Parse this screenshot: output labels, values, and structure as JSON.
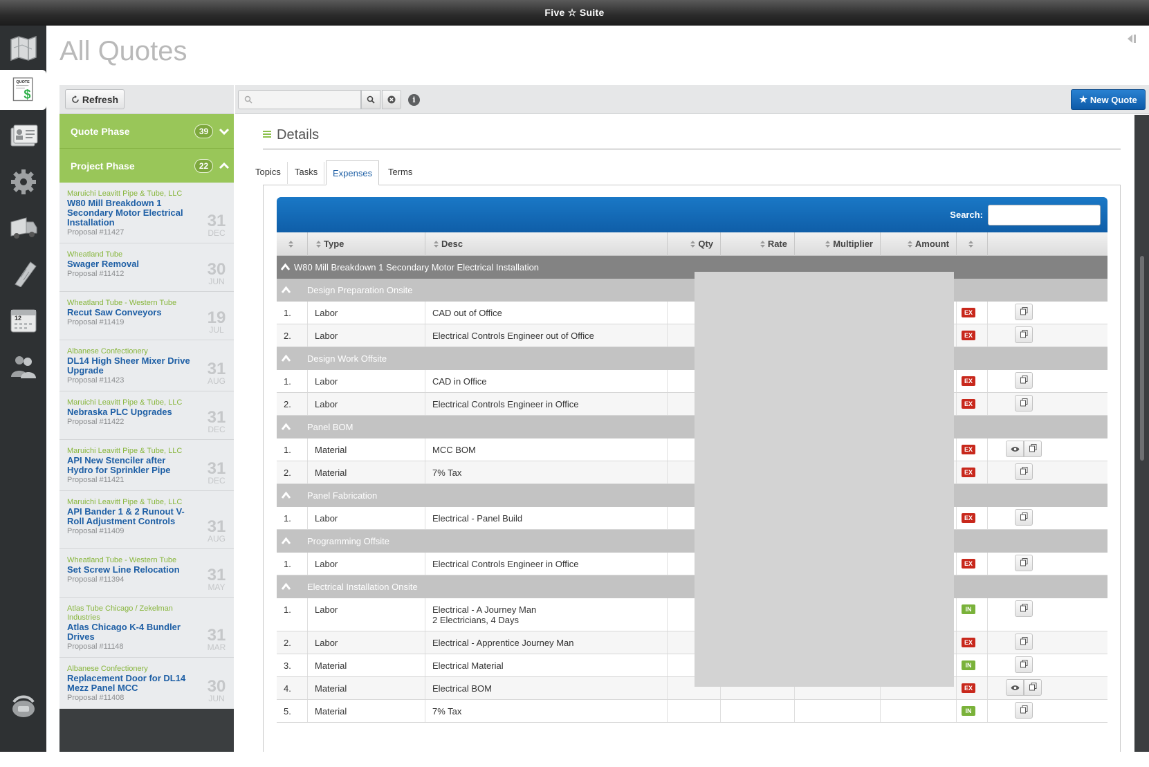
{
  "window": {
    "title": "Five ☆ Suite"
  },
  "page": {
    "title": "All Quotes"
  },
  "dock": {
    "items": [
      {
        "name": "map-icon"
      },
      {
        "name": "quote-icon",
        "label": "QUOTE"
      },
      {
        "name": "contact-card-icon"
      },
      {
        "name": "gear-icon"
      },
      {
        "name": "truck-icon"
      },
      {
        "name": "blueprint-icon"
      },
      {
        "name": "calendar-icon",
        "label": "12"
      },
      {
        "name": "users-icon"
      },
      {
        "name": "phone-icon"
      }
    ]
  },
  "list": {
    "refresh_label": "Refresh",
    "phases": [
      {
        "label": "Quote Phase",
        "count": "39",
        "expanded": false
      },
      {
        "label": "Project Phase",
        "count": "22",
        "expanded": true
      }
    ],
    "quotes": [
      {
        "company": "Maruichi Leavitt Pipe & Tube, LLC",
        "title": "W80 Mill Breakdown 1 Secondary Motor Electrical Installation",
        "proposal": "Proposal #11427",
        "day": "31",
        "month": "DEC"
      },
      {
        "company": "Wheatland Tube",
        "title": "Swager Removal",
        "proposal": "Proposal #11412",
        "day": "30",
        "month": "JUN"
      },
      {
        "company": "Wheatland Tube - Western Tube",
        "title": "Recut Saw Conveyors",
        "proposal": "Proposal #11419",
        "day": "19",
        "month": "JUL"
      },
      {
        "company": "Albanese Confectionery",
        "title": "DL14 High Sheer Mixer Drive Upgrade",
        "proposal": "Proposal #11423",
        "day": "31",
        "month": "AUG"
      },
      {
        "company": "Maruichi Leavitt Pipe & Tube, LLC",
        "title": "Nebraska PLC Upgrades",
        "proposal": "Proposal #11422",
        "day": "31",
        "month": "DEC"
      },
      {
        "company": "Maruichi Leavitt Pipe & Tube, LLC",
        "title": "API New Stenciler after Hydro for Sprinkler Pipe",
        "proposal": "Proposal #11421",
        "day": "31",
        "month": "DEC"
      },
      {
        "company": "Maruichi Leavitt Pipe & Tube, LLC",
        "title": "API Bander 1 & 2 Runout V-Roll Adjustment Controls",
        "proposal": "Proposal #11409",
        "day": "31",
        "month": "AUG"
      },
      {
        "company": "Wheatland Tube - Western Tube",
        "title": "Set Screw Line Relocation",
        "proposal": "Proposal #11394",
        "day": "31",
        "month": "MAY"
      },
      {
        "company": "Atlas Tube Chicago / Zekelman Industries",
        "title": "Atlas Chicago K-4 Bundler Drives",
        "proposal": "Proposal #11148",
        "day": "31",
        "month": "MAR"
      },
      {
        "company": "Albanese Confectionery",
        "title": "Replacement Door for DL14 Mezz Panel MCC",
        "proposal": "Proposal #11408",
        "day": "30",
        "month": "JUN"
      }
    ]
  },
  "toolbar": {
    "search_placeholder": "",
    "new_quote_label": "New Quote",
    "info_label": "i"
  },
  "details": {
    "title": "Details",
    "tabs": [
      "Topics",
      "Tasks",
      "Expenses",
      "Terms"
    ],
    "active_tab": "Expenses",
    "grid": {
      "search_label": "Search:",
      "columns": [
        "Type",
        "Desc",
        "Qty",
        "Rate",
        "Multiplier",
        "Amount"
      ],
      "top_group": "W80 Mill Breakdown 1 Secondary Motor Electrical Installation",
      "groups": [
        {
          "name": "Design Preparation Onsite",
          "rows": [
            {
              "n": "1.",
              "type": "Labor",
              "desc": "CAD out of Office",
              "flag": "EX",
              "actions": [
                "copy"
              ]
            },
            {
              "n": "2.",
              "type": "Labor",
              "desc": "Electrical Controls Engineer out of Office",
              "flag": "EX",
              "actions": [
                "copy"
              ]
            }
          ]
        },
        {
          "name": "Design Work Offsite",
          "rows": [
            {
              "n": "1.",
              "type": "Labor",
              "desc": "CAD in Office",
              "flag": "EX",
              "actions": [
                "copy"
              ]
            },
            {
              "n": "2.",
              "type": "Labor",
              "desc": "Electrical Controls Engineer in Office",
              "flag": "EX",
              "actions": [
                "copy"
              ]
            }
          ]
        },
        {
          "name": "Panel BOM",
          "rows": [
            {
              "n": "1.",
              "type": "Material",
              "desc": "MCC BOM",
              "flag": "EX",
              "actions": [
                "view",
                "copy"
              ]
            },
            {
              "n": "2.",
              "type": "Material",
              "desc": "7% Tax",
              "flag": "EX",
              "actions": [
                "copy"
              ]
            }
          ]
        },
        {
          "name": "Panel Fabrication",
          "rows": [
            {
              "n": "1.",
              "type": "Labor",
              "desc": "Electrical - Panel Build",
              "flag": "EX",
              "actions": [
                "copy"
              ]
            }
          ]
        },
        {
          "name": "Programming Offsite",
          "rows": [
            {
              "n": "1.",
              "type": "Labor",
              "desc": "Electrical Controls Engineer in Office",
              "flag": "EX",
              "actions": [
                "copy"
              ]
            }
          ]
        },
        {
          "name": "Electrical Installation Onsite",
          "rows": [
            {
              "n": "1.",
              "type": "Labor",
              "desc": "Electrical - A Journey Man",
              "desc2": "2 Electricians, 4 Days",
              "flag": "IN",
              "actions": [
                "copy"
              ]
            },
            {
              "n": "2.",
              "type": "Labor",
              "desc": "Electrical - Apprentice Journey Man",
              "flag": "EX",
              "actions": [
                "copy"
              ]
            },
            {
              "n": "3.",
              "type": "Material",
              "desc": "Electrical Material",
              "flag": "IN",
              "actions": [
                "copy"
              ]
            },
            {
              "n": "4.",
              "type": "Material",
              "desc": "Electrical BOM",
              "flag": "EX",
              "actions": [
                "view",
                "copy"
              ]
            },
            {
              "n": "5.",
              "type": "Material",
              "desc": "7% Tax",
              "flag": "IN",
              "actions": [
                "copy"
              ]
            }
          ]
        }
      ]
    }
  },
  "colors": {
    "accent_green": "#99c659",
    "link_blue": "#1e5fa5",
    "header_blue": "#0f5ea8",
    "ex_red": "#c8281c",
    "in_green": "#7ab23a"
  }
}
